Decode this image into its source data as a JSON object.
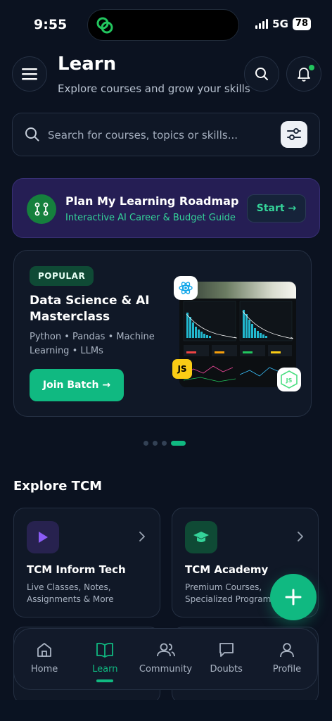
{
  "status_bar": {
    "time": "9:55",
    "network": "5G",
    "battery": "78"
  },
  "header": {
    "title": "Learn",
    "subtitle": "Explore courses and grow your skills"
  },
  "search": {
    "placeholder": "Search for courses, topics or skills..."
  },
  "roadmap": {
    "title": "Plan My Learning Roadmap",
    "subtitle": "Interactive AI Career & Budget Guide",
    "cta": "Start →"
  },
  "featured_course": {
    "badge": "POPULAR",
    "title": "Data Science & AI Masterclass",
    "tags": "Python • Pandas • Machine Learning • LLMs",
    "cta": "Join Batch →",
    "badge_js": "JS",
    "carousel_total": 4,
    "carousel_active": 4
  },
  "explore": {
    "section_title": "Explore TCM",
    "cards": [
      {
        "title": "TCM Inform Tech",
        "description": "Live Classes, Notes, Assignments & More",
        "icon": "play-icon"
      },
      {
        "title": "TCM Academy",
        "description": "Premium Courses, Specialized Programs",
        "icon": "graduation-cap-icon"
      }
    ]
  },
  "bottom_nav": {
    "items": [
      {
        "label": "Home",
        "icon": "home-icon"
      },
      {
        "label": "Learn",
        "icon": "book-icon"
      },
      {
        "label": "Community",
        "icon": "users-icon"
      },
      {
        "label": "Doubts",
        "icon": "chat-icon"
      },
      {
        "label": "Profile",
        "icon": "user-icon"
      }
    ],
    "active": "Learn"
  },
  "colors": {
    "background": "#0b1220",
    "accent": "#10b981",
    "banner": "#251e54",
    "text_secondary": "#aab4c3"
  }
}
